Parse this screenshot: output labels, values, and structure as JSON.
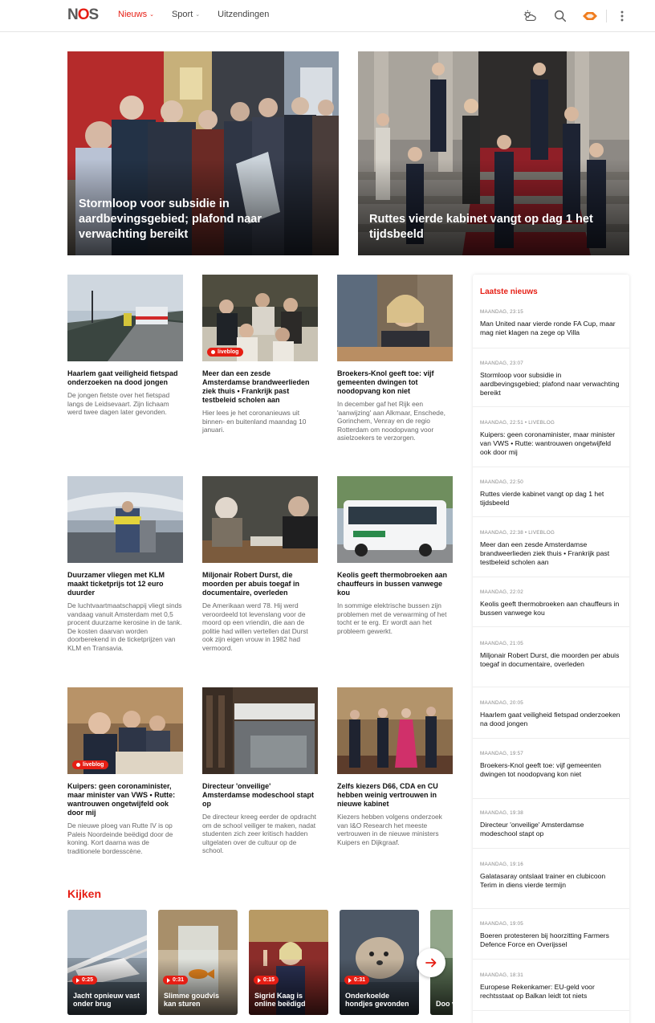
{
  "header": {
    "logo": {
      "n": "N",
      "o": "O",
      "s": "S"
    },
    "nav": [
      {
        "label": "Nieuws",
        "has_dropdown": true,
        "active": true
      },
      {
        "label": "Sport",
        "has_dropdown": true,
        "active": false
      },
      {
        "label": "Uitzendingen",
        "has_dropdown": false,
        "active": false
      }
    ],
    "icons": [
      "weather-icon",
      "search-icon",
      "nos-app-icon",
      "more-vertical-icon"
    ],
    "accent_color": "#e61e14"
  },
  "hero": [
    {
      "title": "Stormloop voor subsidie in aardbevingsgebied; plafond naar verwachting bereikt"
    },
    {
      "title": "Ruttes vierde kabinet vangt op dag 1 het tijdsbeeld"
    }
  ],
  "articles": [
    {
      "title": "Haarlem gaat veiligheid fietspad onderzoeken na dood jongen",
      "text": "De jongen fietste over het fietspad langs de Leidsevaart. Zijn lichaam werd twee dagen later gevonden.",
      "liveblog": false
    },
    {
      "title": "Meer dan een zesde Amsterdamse brandweerlieden ziek thuis • Frankrijk past testbeleid scholen aan",
      "text": "Hier lees je het coronanieuws uit binnen- en buitenland maandag 10 januari.",
      "liveblog": true
    },
    {
      "title": "Broekers-Knol geeft toe: vijf gemeenten dwingen tot noodopvang kon niet",
      "text": "In december gaf het Rijk een 'aanwijzing' aan Alkmaar, Enschede, Gorinchem, Venray en de regio Rotterdam om noodopvang voor asielzoekers te verzorgen.",
      "liveblog": false
    },
    {
      "title": "Duurzamer vliegen met KLM maakt ticketprijs tot 12 euro duurder",
      "text": "De luchtvaartmaatschappij vliegt sinds vandaag vanuit Amsterdam met 0,5 procent duurzame kerosine in de tank. De kosten daarvan worden doorberekend in de ticketprijzen van KLM en Transavia.",
      "liveblog": false
    },
    {
      "title": "Miljonair Robert Durst, die moorden per abuis toegaf in documentaire, overleden",
      "text": "De Amerikaan werd 78. Hij werd veroordeeld tot levenslang voor de moord op een vriendin, die aan de politie had willen vertellen dat Durst ook zijn eigen vrouw in 1982 had vermoord.",
      "liveblog": false
    },
    {
      "title": "Keolis geeft thermobroeken aan chauffeurs in bussen vanwege kou",
      "text": "In sommige elektrische bussen zijn problemen met de verwarming of het tocht er te erg. Er wordt aan het probleem gewerkt.",
      "liveblog": false
    },
    {
      "title": "Kuipers: geen coronaminister, maar minister van VWS • Rutte: wantrouwen ongetwijfeld ook door mij",
      "text": "De nieuwe ploeg van Rutte IV is op Paleis Noordeinde beëdigd door de koning. Kort daarna was de traditionele bordesscène.",
      "liveblog": true
    },
    {
      "title": "Directeur 'onveilige' Amsterdamse modeschool stapt op",
      "text": "De directeur kreeg eerder de opdracht om de school veiliger te maken, nadat studenten zich zeer kritisch hadden uitgelaten over de cultuur op de school.",
      "liveblog": false
    },
    {
      "title": "Zelfs kiezers D66, CDA en CU hebben weinig vertrouwen in nieuwe kabinet",
      "text": "Kiezers hebben volgens onderzoek van I&O Research het meeste vertrouwen in de nieuwe ministers Kuipers en Dijkgraaf.",
      "liveblog": false
    }
  ],
  "liveblog_label": "liveblog",
  "sidebar": {
    "title": "Laatste nieuws",
    "items": [
      {
        "meta": "MAANDAG, 23:15",
        "headline": "Man United naar vierde ronde FA Cup, maar mag niet klagen na zege op Villa"
      },
      {
        "meta": "MAANDAG, 23:07",
        "headline": "Stormloop voor subsidie in aardbevingsgebied; plafond naar verwachting bereikt"
      },
      {
        "meta": "MAANDAG, 22:51 • LIVEBLOG",
        "headline": "Kuipers: geen coronaminister, maar minister van VWS • Rutte: wantrouwen ongetwijfeld ook door mij"
      },
      {
        "meta": "MAANDAG, 22:50",
        "headline": "Ruttes vierde kabinet vangt op dag 1 het tijdsbeeld"
      },
      {
        "meta": "MAANDAG, 22:38 • LIVEBLOG",
        "headline": "Meer dan een zesde Amsterdamse brandweerlieden ziek thuis • Frankrijk past testbeleid scholen aan"
      },
      {
        "meta": "MAANDAG, 22:02",
        "headline": "Keolis geeft thermobroeken aan chauffeurs in bussen vanwege kou"
      },
      {
        "meta": "MAANDAG, 21:05",
        "headline": "Miljonair Robert Durst, die moorden per abuis toegaf in documentaire, overleden"
      },
      {
        "meta": "MAANDAG, 20:05",
        "headline": "Haarlem gaat veiligheid fietspad onderzoeken na dood jongen"
      },
      {
        "meta": "MAANDAG, 19:57",
        "headline": "Broekers-Knol geeft toe: vijf gemeenten dwingen tot noodopvang kon niet"
      },
      {
        "meta": "MAANDAG, 19:38",
        "headline": "Directeur 'onveilige' Amsterdamse modeschool stapt op"
      },
      {
        "meta": "MAANDAG, 19:16",
        "headline": "Galatasaray ontslaat trainer en clubicoon Terim in diens vierde termijn"
      },
      {
        "meta": "MAANDAG, 19:05",
        "headline": "Boeren protesteren bij hoorzitting Farmers Defence Force en Overijssel"
      },
      {
        "meta": "MAANDAG, 18:31",
        "headline": "Europese Rekenkamer: EU-geld voor rechtsstaat op Balkan leidt tot niets"
      }
    ]
  },
  "kijken": {
    "title": "Kijken",
    "videos": [
      {
        "duration": "0:25",
        "title": "Jacht opnieuw vast onder brug"
      },
      {
        "duration": "0:31",
        "title": "Slimme goudvis kan sturen"
      },
      {
        "duration": "0:15",
        "title": "Sigrid Kaag is online beëdigd"
      },
      {
        "duration": "0:31",
        "title": "Onderkoelde hondjes gevonden"
      },
      {
        "duration": "",
        "title": "Doo veld"
      }
    ]
  }
}
